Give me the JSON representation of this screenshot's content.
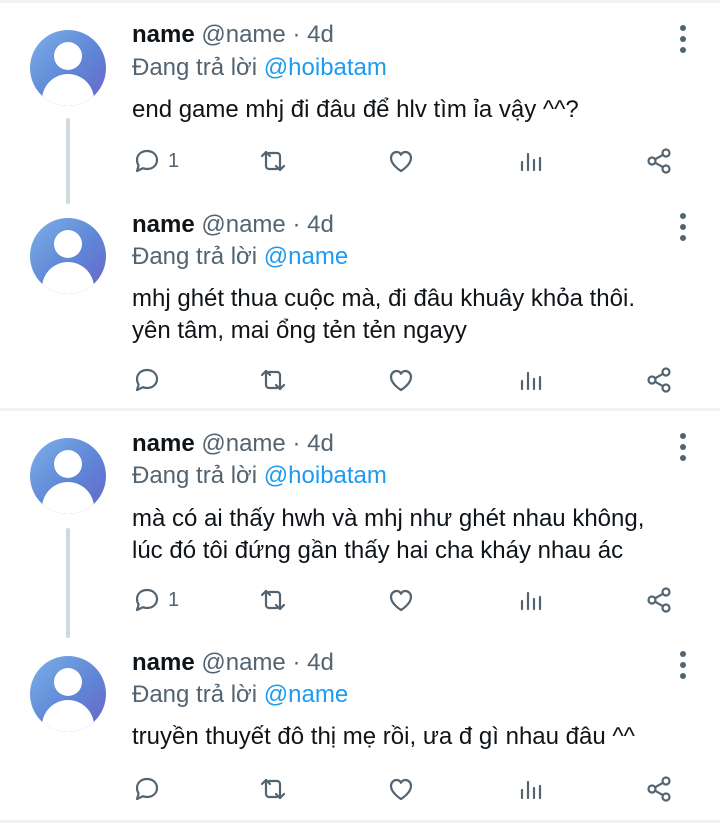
{
  "tweets": [
    {
      "name": "name",
      "handle": "@name",
      "time": "· 4d",
      "reply_prefix": "Đang trả lời",
      "reply_to": "@hoibatam",
      "text": "end game mhj đi đâu để hlv tìm ỉa vậy ^^?",
      "reply_count": "1",
      "icons": [
        "reply-icon",
        "retweet-icon",
        "like-icon",
        "views-icon",
        "share-icon"
      ]
    },
    {
      "name": "name",
      "handle": "@name",
      "time": "· 4d",
      "reply_prefix": "Đang trả lời",
      "reply_to": "@name",
      "text": "mhj ghét thua cuộc mà, đi đâu khuây khỏa thôi.\nyên tâm, mai ổng tẻn tẻn ngayy",
      "reply_count": "",
      "icons": [
        "reply-icon",
        "retweet-icon",
        "like-icon",
        "views-icon",
        "share-icon"
      ]
    },
    {
      "name": "name",
      "handle": "@name",
      "time": "· 4d",
      "reply_prefix": "Đang trả lời",
      "reply_to": "@hoibatam",
      "text": "mà có ai thấy hwh và mhj như ghét nhau không,\nlúc đó tôi đứng gần thấy hai cha kháy nhau ác",
      "reply_count": "1",
      "icons": [
        "reply-icon",
        "retweet-icon",
        "like-icon",
        "views-icon",
        "share-icon"
      ]
    },
    {
      "name": "name",
      "handle": "@name",
      "time": "· 4d",
      "reply_prefix": "Đang trả lời",
      "reply_to": "@name",
      "text": "truyền thuyết đô thị mẹ rồi, ưa đ gì nhau đâu ^^",
      "reply_count": "",
      "icons": [
        "reply-icon",
        "retweet-icon",
        "like-icon",
        "views-icon",
        "share-icon"
      ]
    }
  ],
  "colors": {
    "text": "#0f1419",
    "secondary": "#536471",
    "link": "#1d9bf0",
    "divider": "#eff3f4",
    "thread_line": "#cfd9de"
  }
}
